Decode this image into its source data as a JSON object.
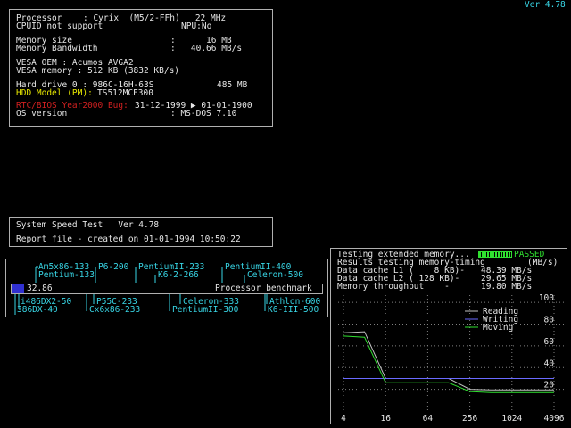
{
  "version": "Ver 4.78",
  "info": {
    "processor_label": "Processor",
    "processor_value": ": Cyrix  (M5/2-FFh)   22 MHz",
    "cpuid": "CPUID not support",
    "npu": "NPU:No",
    "mem_size_label": "Memory size",
    "mem_size_value": ":      16 MB",
    "mem_bw_label": "Memory Bandwidth",
    "mem_bw_value": ":   40.66 MB/s",
    "vesa_oem": "VESA OEM : Acumos AVGA2",
    "vesa_mem": "VESA memory : 512 KB (3832 KB/s)",
    "hdd0_label": "Hard drive 0 : 986C-16H-63S",
    "hdd0_size": "485 MB",
    "hdd_model_label": "HDD Model (PM):",
    "hdd_model_value": "TS512MCF300",
    "rtc_label": "RTC/BIOS Year2000 Bug:",
    "rtc_value": "31-12-1999 ▶ 01-01-1900",
    "os_label": "OS version",
    "os_value": ": MS-DOS 7.10"
  },
  "speedtest": {
    "title": "System Speed Test   Ver 4.78",
    "report": "Report file - created on 01-01-1994 10:50:22"
  },
  "benchmark": {
    "top_row1": [
      "Am5x86-133",
      "P6-200",
      "PentiumII-233",
      "PentiumII-400"
    ],
    "top_row2": [
      "Pentium-133",
      "K6-2-266",
      "Celeron-500"
    ],
    "score": "32.86",
    "caption": "Processor benchmark",
    "bottom_row1": [
      "i486DX2-50",
      "P55C-233",
      "Celeron-333",
      "Athlon-600"
    ],
    "bottom_row2": [
      "386DX-40",
      "Cx6x86-233",
      "PentiumII-300",
      "K6-III-500"
    ],
    "score_fraction": 0.04
  },
  "memtest": {
    "testing": "Testing extended memory...",
    "passed": "PASSED",
    "results": "Results testing memory-timing",
    "unit": "(MB/s)",
    "l1_label": "Data cache L1 (    8 KB)-",
    "l1_value": "48.39 MB/s",
    "l2_label": "Data cache L2 ( 128 KB)-",
    "l2_value": "29.65 MB/s",
    "mem_label": "Memory throughput    -",
    "mem_value": "19.80 MB/s",
    "legend": [
      "Reading",
      "Writing",
      "Moving"
    ],
    "colors": {
      "reading": "#6a6aff",
      "writing": "#6a6aff",
      "moving": "#30e030"
    }
  },
  "chart_data": {
    "type": "line",
    "x_ticks": [
      "4",
      "16",
      "64",
      "256",
      "1024",
      "4096"
    ],
    "y_ticks": [
      "100",
      "80",
      "60",
      "40",
      "20"
    ],
    "ylim": [
      0,
      110
    ],
    "x": [
      4,
      8,
      16,
      32,
      64,
      128,
      256,
      512,
      1024,
      2048,
      4096
    ],
    "series": [
      {
        "name": "Reading",
        "values": [
          72,
          73,
          30,
          30,
          30,
          30,
          20,
          19.5,
          19.5,
          19.5,
          19.5
        ]
      },
      {
        "name": "Writing",
        "values": [
          30,
          30,
          30,
          30,
          30,
          30,
          30,
          30,
          30,
          30,
          30
        ]
      },
      {
        "name": "Moving",
        "values": [
          69,
          68,
          26,
          26,
          26,
          26,
          18,
          17,
          17,
          17,
          17
        ]
      }
    ]
  }
}
